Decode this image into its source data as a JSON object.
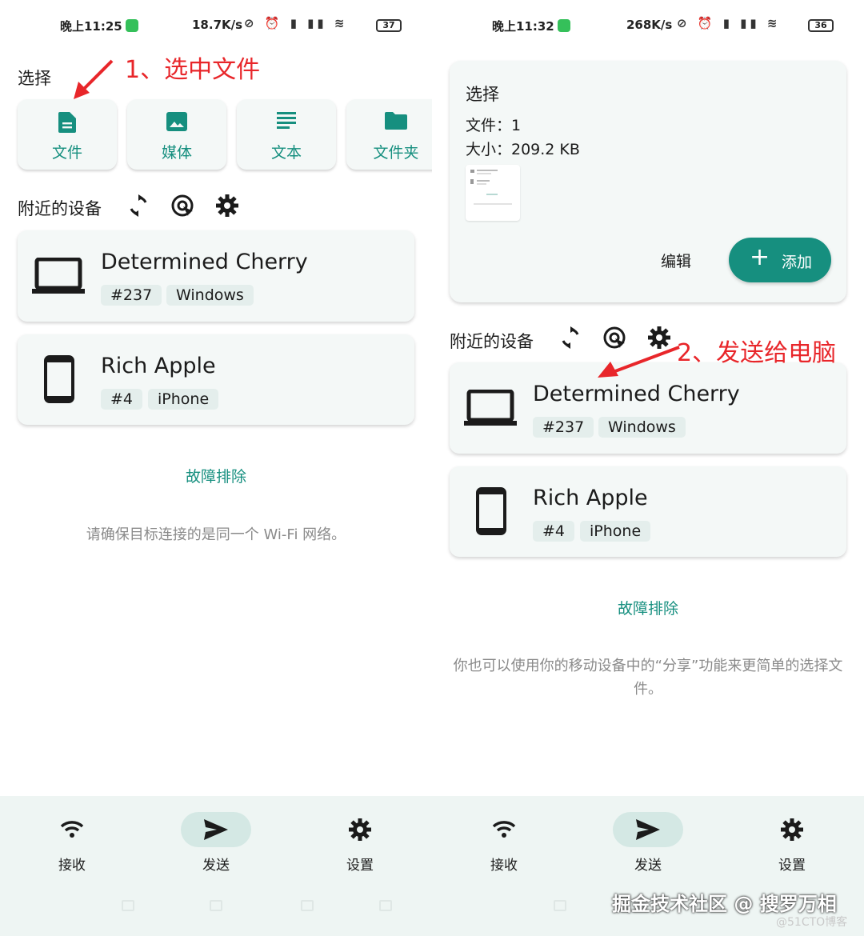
{
  "left": {
    "status": {
      "time": "晚上11:25",
      "speed": "18.7K/s",
      "battery": "37"
    },
    "select_label": "选择",
    "categories": [
      {
        "label": "文件",
        "icon": "file-icon"
      },
      {
        "label": "媒体",
        "icon": "image-icon"
      },
      {
        "label": "文本",
        "icon": "text-icon"
      },
      {
        "label": "文件夹",
        "icon": "folder-icon"
      }
    ],
    "nearby_label": "附近的设备",
    "devices": [
      {
        "name": "Determined Cherry",
        "tags": [
          "#237",
          "Windows"
        ],
        "icon": "laptop-icon"
      },
      {
        "name": "Rich Apple",
        "tags": [
          "#4",
          "iPhone"
        ],
        "icon": "phone-icon"
      }
    ],
    "troubleshoot": "故障排除",
    "hint": "请确保目标连接的是同一个 Wi-Fi 网络。",
    "annotation": "1、选中文件"
  },
  "right": {
    "status": {
      "time": "晚上11:32",
      "speed": "268K/s",
      "battery": "36"
    },
    "selection": {
      "title": "选择",
      "files_line": "文件：1",
      "size_line": "大小：209.2 KB",
      "edit": "编辑",
      "add": "添加"
    },
    "nearby_label": "附近的设备",
    "devices": [
      {
        "name": "Determined Cherry",
        "tags": [
          "#237",
          "Windows"
        ],
        "icon": "laptop-icon"
      },
      {
        "name": "Rich Apple",
        "tags": [
          "#4",
          "iPhone"
        ],
        "icon": "phone-icon"
      }
    ],
    "troubleshoot": "故障排除",
    "hint": "你也可以使用你的移动设备中的“分享”功能来更简单的选择文件。",
    "annotation": "2、发送给电脑"
  },
  "nav": [
    {
      "label": "接收",
      "icon": "wifi-icon"
    },
    {
      "label": "发送",
      "icon": "send-icon"
    },
    {
      "label": "设置",
      "icon": "gear-icon"
    }
  ],
  "watermark": "掘金技术社区 @ 搜罗万相",
  "watermark_small": "@51CTO博客",
  "colors": {
    "accent": "#168f7f",
    "annotation": "#e8262a",
    "nav_bg": "#eef5f3"
  }
}
